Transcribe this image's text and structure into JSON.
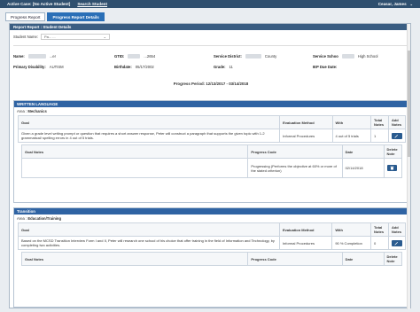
{
  "topbar": {
    "case_label": "Active Case: [No Active Student]",
    "search_label": "Search Student",
    "user_name": "Ceasar, James",
    "user_chevron": "⌄"
  },
  "tabs": [
    {
      "label": "Progress Report"
    },
    {
      "label": "Progress Report Details"
    }
  ],
  "panel_title": "Report Report : Student Details",
  "student_select": {
    "label": "Student Name:",
    "value": "Pa... ...",
    "chevron": "⌄"
  },
  "student_info": {
    "name_label": "Name:",
    "name_value": "...er",
    "gtid_label": "GTID:",
    "gtid_value": "...2654",
    "district_label": "Service District:",
    "district_value": "County",
    "school_label": "Service Schoo",
    "school_value": "High School",
    "disability_label": "Primary Disability:",
    "disability_value": "AUTISM",
    "birthdate_label": "Birthdate:",
    "birthdate_value": "05/17/2002",
    "grade_label": "Grade:",
    "grade_value": "11",
    "iep_label": "IEP Due Date:",
    "iep_value": ""
  },
  "period": "Progress Period: 12/13/2017 - 03/14/2018",
  "sections": [
    {
      "title": "WRITTEN LANGUAGE",
      "area_label": "Area :",
      "area_value": "Mechanics",
      "goal_headers": [
        "Goal",
        "Evaluation Method",
        "With",
        "Total Notes",
        "Add Notes"
      ],
      "goal": {
        "text": "Given a grade level writing prompt or question that requires a short answer response, Peter will construct a paragraph that supports the given topic with 1-2 grammatical/ spelling errors in 4 out of 5 trials.",
        "method": "Informal Procedures",
        "with": "4 out of 5 trials",
        "total": "1"
      },
      "note_headers": [
        "Goal Notes",
        "Progress Code",
        "Date",
        "Delete Note"
      ],
      "note": {
        "text": "",
        "code": "Progressing (Performs the objective at 60% or more of the stated criterion)",
        "date": "02/14/2018"
      }
    },
    {
      "title": "Transition",
      "area_label": "Area :",
      "area_value": "Education/Training",
      "goal_headers": [
        "Goal",
        "Evaluation Method",
        "With",
        "Total Notes",
        "Add Notes"
      ],
      "goal": {
        "text": "Based on the MCSD Transition Interview Form I and II, Peter will research one school of his choice that offer training in the field of Information and Technology, by completing two activities.",
        "method": "Informal Procedures",
        "with": "90 % Completion",
        "total": "0"
      },
      "note_headers": [
        "Goal Notes",
        "Progress Code",
        "Date",
        "Delete Note"
      ]
    }
  ],
  "colors": {
    "topbar": "#2f4f6e",
    "tab_active": "#2a6fb7",
    "section_head": "#2f63a3",
    "button": "#2a5b8f"
  }
}
